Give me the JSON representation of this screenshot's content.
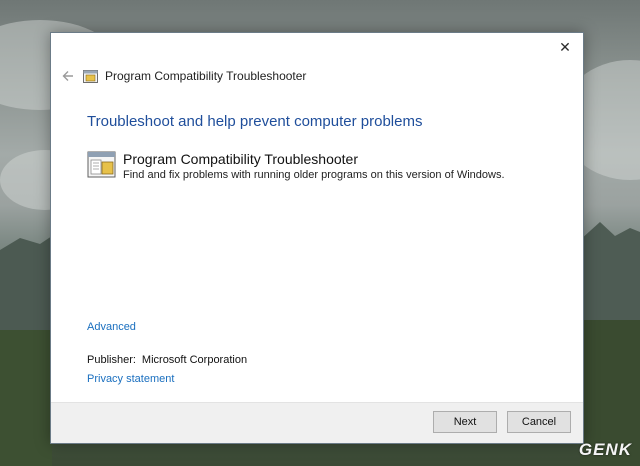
{
  "window": {
    "title": "Program Compatibility Troubleshooter",
    "close_glyph": "✕"
  },
  "main": {
    "heading": "Troubleshoot and help prevent computer problems",
    "item": {
      "title": "Program Compatibility Troubleshooter",
      "description": "Find and fix problems with running older programs on this version of Windows."
    },
    "advanced_link": "Advanced",
    "publisher_label": "Publisher:",
    "publisher_value": "Microsoft Corporation",
    "privacy_link": "Privacy statement"
  },
  "footer": {
    "next_label": "Next",
    "cancel_label": "Cancel"
  },
  "watermark": "GENK",
  "icons": {
    "back": "back-arrow-icon",
    "program": "program-compatibility-icon",
    "close": "close-icon"
  },
  "colors": {
    "heading": "#1f4e9b",
    "link": "#1a6fbf",
    "footer_bg": "#f0f0f0"
  }
}
